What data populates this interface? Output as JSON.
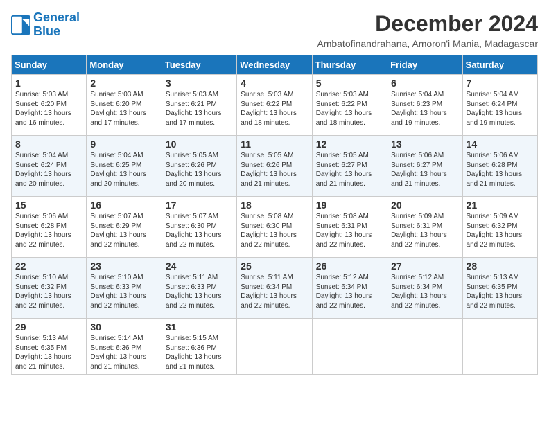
{
  "logo": {
    "line1": "General",
    "line2": "Blue"
  },
  "title": "December 2024",
  "subtitle": "Ambatofinandrahana, Amoron'i Mania, Madagascar",
  "headers": [
    "Sunday",
    "Monday",
    "Tuesday",
    "Wednesday",
    "Thursday",
    "Friday",
    "Saturday"
  ],
  "weeks": [
    [
      {
        "day": "1",
        "text": "Sunrise: 5:03 AM\nSunset: 6:20 PM\nDaylight: 13 hours and 16 minutes."
      },
      {
        "day": "2",
        "text": "Sunrise: 5:03 AM\nSunset: 6:20 PM\nDaylight: 13 hours and 17 minutes."
      },
      {
        "day": "3",
        "text": "Sunrise: 5:03 AM\nSunset: 6:21 PM\nDaylight: 13 hours and 17 minutes."
      },
      {
        "day": "4",
        "text": "Sunrise: 5:03 AM\nSunset: 6:22 PM\nDaylight: 13 hours and 18 minutes."
      },
      {
        "day": "5",
        "text": "Sunrise: 5:03 AM\nSunset: 6:22 PM\nDaylight: 13 hours and 18 minutes."
      },
      {
        "day": "6",
        "text": "Sunrise: 5:04 AM\nSunset: 6:23 PM\nDaylight: 13 hours and 19 minutes."
      },
      {
        "day": "7",
        "text": "Sunrise: 5:04 AM\nSunset: 6:24 PM\nDaylight: 13 hours and 19 minutes."
      }
    ],
    [
      {
        "day": "8",
        "text": "Sunrise: 5:04 AM\nSunset: 6:24 PM\nDaylight: 13 hours and 20 minutes."
      },
      {
        "day": "9",
        "text": "Sunrise: 5:04 AM\nSunset: 6:25 PM\nDaylight: 13 hours and 20 minutes."
      },
      {
        "day": "10",
        "text": "Sunrise: 5:05 AM\nSunset: 6:26 PM\nDaylight: 13 hours and 20 minutes."
      },
      {
        "day": "11",
        "text": "Sunrise: 5:05 AM\nSunset: 6:26 PM\nDaylight: 13 hours and 21 minutes."
      },
      {
        "day": "12",
        "text": "Sunrise: 5:05 AM\nSunset: 6:27 PM\nDaylight: 13 hours and 21 minutes."
      },
      {
        "day": "13",
        "text": "Sunrise: 5:06 AM\nSunset: 6:27 PM\nDaylight: 13 hours and 21 minutes."
      },
      {
        "day": "14",
        "text": "Sunrise: 5:06 AM\nSunset: 6:28 PM\nDaylight: 13 hours and 21 minutes."
      }
    ],
    [
      {
        "day": "15",
        "text": "Sunrise: 5:06 AM\nSunset: 6:28 PM\nDaylight: 13 hours and 22 minutes."
      },
      {
        "day": "16",
        "text": "Sunrise: 5:07 AM\nSunset: 6:29 PM\nDaylight: 13 hours and 22 minutes."
      },
      {
        "day": "17",
        "text": "Sunrise: 5:07 AM\nSunset: 6:30 PM\nDaylight: 13 hours and 22 minutes."
      },
      {
        "day": "18",
        "text": "Sunrise: 5:08 AM\nSunset: 6:30 PM\nDaylight: 13 hours and 22 minutes."
      },
      {
        "day": "19",
        "text": "Sunrise: 5:08 AM\nSunset: 6:31 PM\nDaylight: 13 hours and 22 minutes."
      },
      {
        "day": "20",
        "text": "Sunrise: 5:09 AM\nSunset: 6:31 PM\nDaylight: 13 hours and 22 minutes."
      },
      {
        "day": "21",
        "text": "Sunrise: 5:09 AM\nSunset: 6:32 PM\nDaylight: 13 hours and 22 minutes."
      }
    ],
    [
      {
        "day": "22",
        "text": "Sunrise: 5:10 AM\nSunset: 6:32 PM\nDaylight: 13 hours and 22 minutes."
      },
      {
        "day": "23",
        "text": "Sunrise: 5:10 AM\nSunset: 6:33 PM\nDaylight: 13 hours and 22 minutes."
      },
      {
        "day": "24",
        "text": "Sunrise: 5:11 AM\nSunset: 6:33 PM\nDaylight: 13 hours and 22 minutes."
      },
      {
        "day": "25",
        "text": "Sunrise: 5:11 AM\nSunset: 6:34 PM\nDaylight: 13 hours and 22 minutes."
      },
      {
        "day": "26",
        "text": "Sunrise: 5:12 AM\nSunset: 6:34 PM\nDaylight: 13 hours and 22 minutes."
      },
      {
        "day": "27",
        "text": "Sunrise: 5:12 AM\nSunset: 6:34 PM\nDaylight: 13 hours and 22 minutes."
      },
      {
        "day": "28",
        "text": "Sunrise: 5:13 AM\nSunset: 6:35 PM\nDaylight: 13 hours and 22 minutes."
      }
    ],
    [
      {
        "day": "29",
        "text": "Sunrise: 5:13 AM\nSunset: 6:35 PM\nDaylight: 13 hours and 21 minutes."
      },
      {
        "day": "30",
        "text": "Sunrise: 5:14 AM\nSunset: 6:36 PM\nDaylight: 13 hours and 21 minutes."
      },
      {
        "day": "31",
        "text": "Sunrise: 5:15 AM\nSunset: 6:36 PM\nDaylight: 13 hours and 21 minutes."
      },
      null,
      null,
      null,
      null
    ]
  ]
}
